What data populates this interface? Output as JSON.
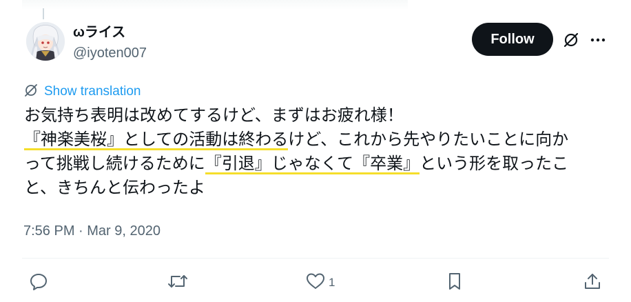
{
  "author": {
    "display_name": "ωライス",
    "handle": "@iyoten007"
  },
  "header": {
    "follow_label": "Follow"
  },
  "translation": {
    "label": "Show translation"
  },
  "tweet": {
    "lines": [
      [
        {
          "text": "お気持ち表明は改めてするけど、まずはお疲れ様！",
          "hl": false
        }
      ],
      [
        {
          "text": "『神楽美桜』としての活動は終わる",
          "hl": true
        },
        {
          "text": "けど、これから先やりたいことに向か",
          "hl": false
        }
      ],
      [
        {
          "text": "って挑戦し続けるために",
          "hl": false
        },
        {
          "text": "『引退』じゃなくて『卒業』",
          "hl": true
        },
        {
          "text": "という形を取ったこ",
          "hl": false
        }
      ],
      [
        {
          "text": "と、きちんと伝わったよ",
          "hl": false
        }
      ]
    ],
    "timestamp": "7:56 PM · Mar 9, 2020"
  },
  "actions": {
    "like_count": "1"
  },
  "colors": {
    "accent": "#1d9bf0",
    "secondary_text": "#536471",
    "highlight": "#f5de2a",
    "follow_bg": "#0f1419"
  },
  "icons": [
    "grok-icon",
    "more-icon",
    "translate-icon",
    "reply-icon",
    "repost-icon",
    "like-icon",
    "bookmark-icon",
    "share-icon"
  ]
}
